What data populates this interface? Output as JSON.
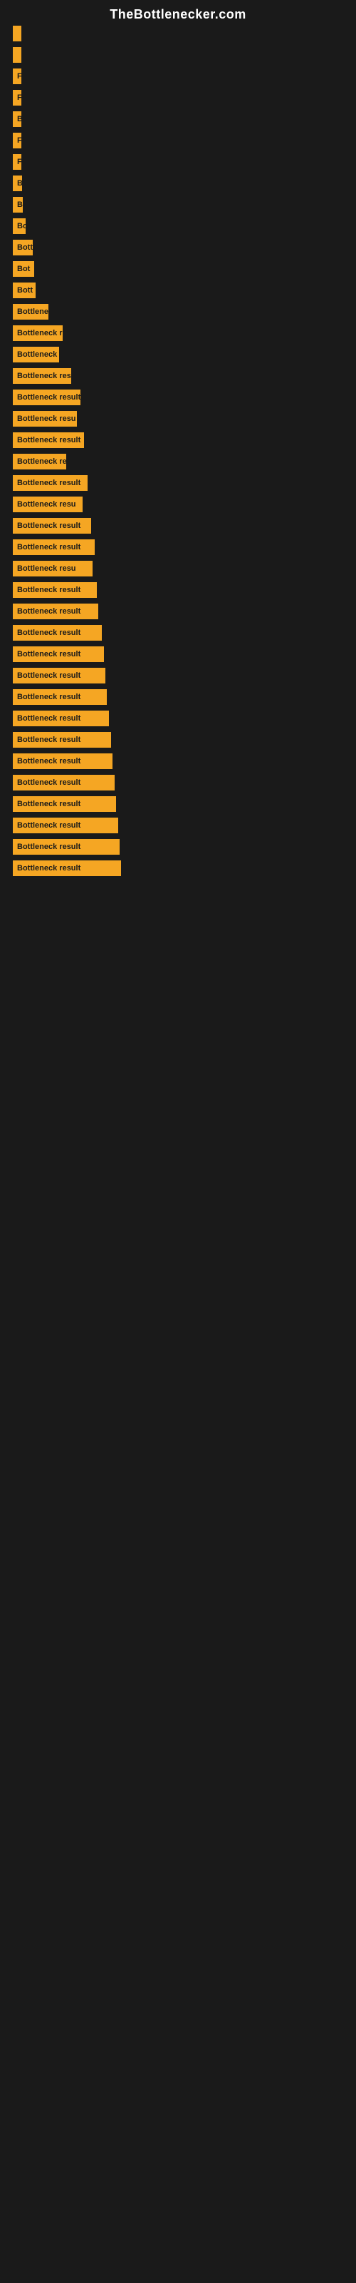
{
  "site": {
    "title": "TheBottlenecker.com"
  },
  "bars": [
    {
      "label": "",
      "width": 2
    },
    {
      "label": "",
      "width": 3
    },
    {
      "label": "F",
      "width": 8
    },
    {
      "label": "F",
      "width": 9
    },
    {
      "label": "B",
      "width": 10
    },
    {
      "label": "F",
      "width": 11
    },
    {
      "label": "F",
      "width": 12
    },
    {
      "label": "B",
      "width": 13
    },
    {
      "label": "B",
      "width": 14
    },
    {
      "label": "Bo",
      "width": 18
    },
    {
      "label": "Bott",
      "width": 28
    },
    {
      "label": "Bot",
      "width": 30
    },
    {
      "label": "Bott",
      "width": 32
    },
    {
      "label": "Bottlenec",
      "width": 50
    },
    {
      "label": "Bottleneck re",
      "width": 70
    },
    {
      "label": "Bottleneck",
      "width": 65
    },
    {
      "label": "Bottleneck resu",
      "width": 82
    },
    {
      "label": "Bottleneck result",
      "width": 95
    },
    {
      "label": "Bottleneck resu",
      "width": 90
    },
    {
      "label": "Bottleneck result",
      "width": 100
    },
    {
      "label": "Bottleneck re",
      "width": 75
    },
    {
      "label": "Bottleneck result",
      "width": 105
    },
    {
      "label": "Bottleneck resu",
      "width": 98
    },
    {
      "label": "Bottleneck result",
      "width": 110
    },
    {
      "label": "Bottleneck result",
      "width": 115
    },
    {
      "label": "Bottleneck resu",
      "width": 112
    },
    {
      "label": "Bottleneck result",
      "width": 118
    },
    {
      "label": "Bottleneck result",
      "width": 120
    },
    {
      "label": "Bottleneck result",
      "width": 125
    },
    {
      "label": "Bottleneck result",
      "width": 128
    },
    {
      "label": "Bottleneck result",
      "width": 130
    },
    {
      "label": "Bottleneck result",
      "width": 132
    },
    {
      "label": "Bottleneck result",
      "width": 135
    },
    {
      "label": "Bottleneck result",
      "width": 138
    },
    {
      "label": "Bottleneck result",
      "width": 140
    },
    {
      "label": "Bottleneck result",
      "width": 143
    },
    {
      "label": "Bottleneck result",
      "width": 145
    },
    {
      "label": "Bottleneck result",
      "width": 148
    },
    {
      "label": "Bottleneck result",
      "width": 150
    },
    {
      "label": "Bottleneck result",
      "width": 152
    }
  ]
}
